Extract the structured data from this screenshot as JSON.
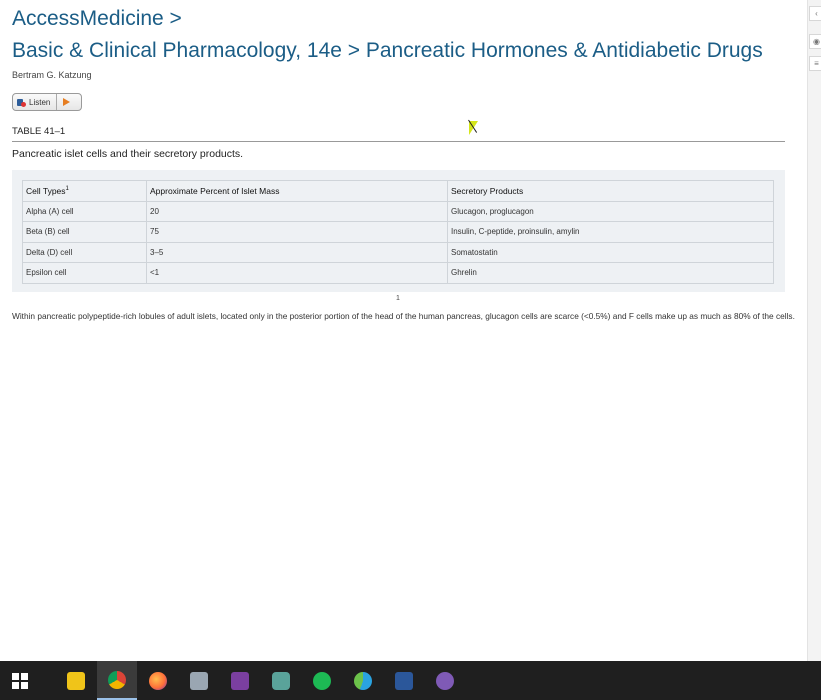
{
  "breadcrumb": {
    "site": "AccessMedicine >",
    "path": "Basic & Clinical Pharmacology, 14e > Pancreatic Hormones & Antidiabetic Drugs"
  },
  "author": "Bertram G. Katzung",
  "listen": {
    "label": "Listen"
  },
  "table": {
    "label": "TABLE 41–1",
    "caption": "Pancreatic islet cells and their secretory products.",
    "headers": [
      "Cell Types",
      "Approximate Percent of Islet Mass",
      "Secretory Products"
    ],
    "header_footnote_mark": "1",
    "rows": [
      [
        "Alpha (A) cell",
        "20",
        "Glucagon, proglucagon"
      ],
      [
        "Beta (B) cell",
        "75",
        "Insulin, C-peptide, proinsulin, amylin"
      ],
      [
        "Delta (D) cell",
        "3–5",
        "Somatostatin"
      ],
      [
        "Epsilon cell",
        "<1",
        "Ghrelin"
      ]
    ]
  },
  "footnote": {
    "number": "1",
    "text": "Within pancreatic polypeptide-rich lobules of adult islets, located only in the posterior portion of the head of the human pancreas, glucagon cells are scarce (<0.5%) and F cells make up as much as 80% of the cells."
  },
  "right_panel": {
    "collapse_icon": "chevron-left-icon",
    "view_icon": "eye-icon",
    "notes_icon": "notes-icon",
    "collapse_glyph": "‹",
    "view_glyph": "◉",
    "notes_glyph": "≡"
  },
  "taskbar": {
    "items": [
      {
        "name": "start-icon"
      },
      {
        "name": "file-explorer-icon",
        "color": "#f0c419"
      },
      {
        "name": "chrome-icon",
        "color": "#4caf50",
        "active": true
      },
      {
        "name": "firefox-icon",
        "color": "#ff7139"
      },
      {
        "name": "app-icon",
        "color": "#9aa6b2"
      },
      {
        "name": "onenote-icon",
        "color": "#7b3fa0"
      },
      {
        "name": "settings-app-icon",
        "color": "#5aa39a"
      },
      {
        "name": "spotify-icon",
        "color": "#1db954"
      },
      {
        "name": "edge-icon",
        "color": "#2aa3e0"
      },
      {
        "name": "word-icon",
        "color": "#2b579a"
      },
      {
        "name": "emacs-icon",
        "color": "#7f5ab6"
      }
    ]
  }
}
